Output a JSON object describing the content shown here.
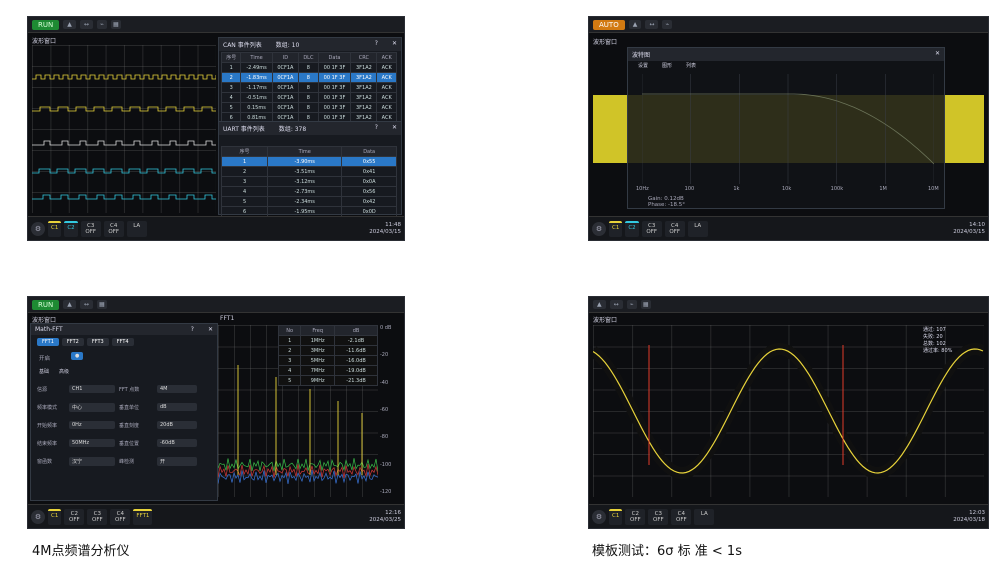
{
  "captions": {
    "fft": "4M点频谱分析仪",
    "mask": "模板测试：6σ 标 准 < 1s"
  },
  "colors": {
    "ch1": "#e8d33a",
    "ch2": "#33c9e0",
    "highlight": "#2a78c7",
    "run": "#1e8a33",
    "auto": "#d27a12"
  },
  "topleft": {
    "window_title": "波形窗口",
    "can_title": "CAN 事件列表",
    "can_count": "数组: 10",
    "can_headers": [
      "序号",
      "Time",
      "ID",
      "DLC",
      "Data",
      "CRC",
      "ACK"
    ],
    "can_rows": [
      [
        "1",
        "-2.49ms",
        "0CF1A",
        "8",
        "00 1F 3F",
        "3F1A2",
        "ACK"
      ],
      [
        "2",
        "-1.83ms",
        "0CF1A",
        "8",
        "00 1F 3F",
        "3F1A2",
        "ACK"
      ],
      [
        "3",
        "-1.17ms",
        "0CF1A",
        "8",
        "00 1F 3F",
        "3F1A2",
        "ACK"
      ],
      [
        "4",
        "-0.51ms",
        "0CF1A",
        "8",
        "00 1F 3F",
        "3F1A2",
        "ACK"
      ],
      [
        "5",
        "0.15ms",
        "0CF1A",
        "8",
        "00 1F 3F",
        "3F1A2",
        "ACK"
      ],
      [
        "6",
        "0.81ms",
        "0CF1A",
        "8",
        "00 1F 3F",
        "3F1A2",
        "ACK"
      ]
    ],
    "uart_title": "UART 事件列表",
    "uart_count": "数组: 378",
    "uart_headers": [
      "序号",
      "Time",
      "Data"
    ],
    "uart_rows": [
      [
        "1",
        "-3.90ms",
        "0x55"
      ],
      [
        "2",
        "-3.51ms",
        "0x41"
      ],
      [
        "3",
        "-3.12ms",
        "0x0A"
      ],
      [
        "4",
        "-2.73ms",
        "0x56"
      ],
      [
        "5",
        "-2.34ms",
        "0x42"
      ],
      [
        "6",
        "-1.95ms",
        "0x0D"
      ]
    ],
    "clock_time": "11:48",
    "clock_date": "2024/03/15"
  },
  "topright": {
    "window_title": "波形窗口",
    "dialog_title": "波特图",
    "tabs": [
      "设置",
      "图形",
      "列表"
    ],
    "x_ticks": [
      "10Hz",
      "100",
      "1k",
      "10k",
      "100k",
      "1M",
      "10M"
    ],
    "readout1": "Gain: 0.12dB",
    "readout2": "Phase: -18.5°",
    "clock_time": "14:10",
    "clock_date": "2024/03/15"
  },
  "bottomleft": {
    "window_title": "波形窗口",
    "math_title": "Math-FFT",
    "fft_tabs": [
      "FFT1",
      "FFT2",
      "FFT3",
      "FFT4"
    ],
    "enable_label": "开启",
    "sub_tabs": [
      "基础",
      "高级"
    ],
    "rows": [
      {
        "label": "信源",
        "value": "CH1",
        "label2": "FFT 点数",
        "value2": "4M"
      },
      {
        "label": "频率模式",
        "value": "中心",
        "label2": "垂直单位",
        "value2": "dB"
      },
      {
        "label": "开始频率",
        "value": "0Hz",
        "label2": "垂直刻度",
        "value2": "20dB"
      },
      {
        "label": "结束频率",
        "value": "50MHz",
        "label2": "垂直位置",
        "value2": "-60dB"
      },
      {
        "label": "窗函数",
        "value": "汉宁",
        "label2": "峰检测",
        "value2": "开"
      }
    ],
    "fft_label": "FFT1",
    "peak_headers": [
      "No",
      "Freq",
      "dB"
    ],
    "peak_rows": [
      [
        "1",
        "1MHz",
        "-2.1dB"
      ],
      [
        "2",
        "3MHz",
        "-11.6dB"
      ],
      [
        "3",
        "5MHz",
        "-16.0dB"
      ],
      [
        "4",
        "7MHz",
        "-19.0dB"
      ],
      [
        "5",
        "9MHz",
        "-21.3dB"
      ]
    ],
    "db_ticks": [
      "0 dB",
      "-20",
      "-40",
      "-60",
      "-80",
      "-100",
      "-120"
    ],
    "clock_time": "12:16",
    "clock_date": "2024/03/25"
  },
  "bottomright": {
    "window_title": "波形窗口",
    "stats_lines": [
      "通过: 107",
      "失败: 20",
      "总数: 102",
      "通过率: 80%"
    ],
    "clock_time": "12:03",
    "clock_date": "2024/03/18"
  },
  "bottom_channels": {
    "ch2_off": "OFF",
    "ch3_off": "OFF",
    "ch4_off": "OFF",
    "ch1_label": "C1",
    "ch2_label": "C2",
    "ch3_label": "C3",
    "ch4_label": "C4",
    "la_label": "LA",
    "run_label": "RUN",
    "auto_label": "AUTO"
  }
}
